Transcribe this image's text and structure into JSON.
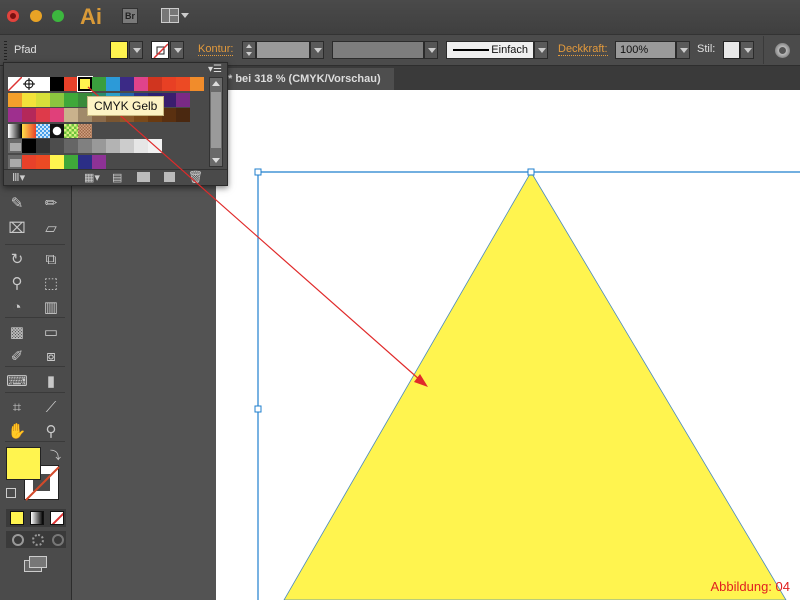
{
  "window": {
    "app_logo": "Ai",
    "bridge_button": "Br",
    "traffic_lights": [
      "close",
      "minimize",
      "zoom"
    ]
  },
  "controlbar": {
    "selection_type": "Pfad",
    "fill_color": "#fff44f",
    "stroke_label": "Kontur:",
    "stroke_weight": "",
    "stroke_profile": "Einfach",
    "opacity_label": "Deckkraft:",
    "opacity_value": "100%",
    "style_label": "Stil:"
  },
  "document_tab": {
    "title": "* bei 318 % (CMYK/Vorschau)"
  },
  "swatches_panel": {
    "tooltip": "CMYK Gelb",
    "rows": [
      [
        "none",
        "registration",
        "#ffffff",
        "#000000",
        "#e8412a",
        "#fff44f",
        "#3a9e3d",
        "#2c9ad8",
        "#3b2a86",
        "#e0438a",
        "#d0351f",
        "#e84024",
        "#ec4a24",
        "#f18c2b"
      ],
      [
        "#f3a02b",
        "#f3e33a",
        "#d7e03a",
        "#8cc63f",
        "#3fa83a",
        "#3a8a3a",
        "#2a8a6a",
        "#2ba0c8",
        "#2364a8",
        "#2b2e86",
        "#2b2070",
        "#3a1e6e",
        "#7a2a86"
      ],
      [
        "#9e2f8e",
        "#b4285a",
        "#de3a4a",
        "#e0407a",
        "#c9b28c",
        "#a08a6a",
        "#8a6a4a",
        "#7a5530",
        "#8a5a2a",
        "#7a4a1a",
        "#6a3a10",
        "#5a3010",
        "#4a2810"
      ],
      [
        "gradient-bw",
        "gradient-orange",
        "pattern-blue",
        "pattern-dots",
        "pattern-green",
        "pattern-brown"
      ],
      [
        "folder",
        "#000000",
        "#333333",
        "#4d4d4d",
        "#666666",
        "#808080",
        "#999999",
        "#b3b3b3",
        "#cccccc",
        "#e6e6e6",
        "#f2f2f2"
      ],
      [
        "folder",
        "#e8412a",
        "#ec4a24",
        "#fff44f",
        "#3fa83a",
        "#2b2e86",
        "#8e3296"
      ]
    ],
    "selected_swatch": "CMYK Gelb"
  },
  "toolbox": {
    "fill_color": "#fff44f",
    "stroke": "none",
    "modes": [
      "color",
      "gradient",
      "none"
    ]
  },
  "artboard": {
    "shape": "triangle",
    "shape_fill": "#fff44f",
    "caption": "Abbildung: 04"
  }
}
